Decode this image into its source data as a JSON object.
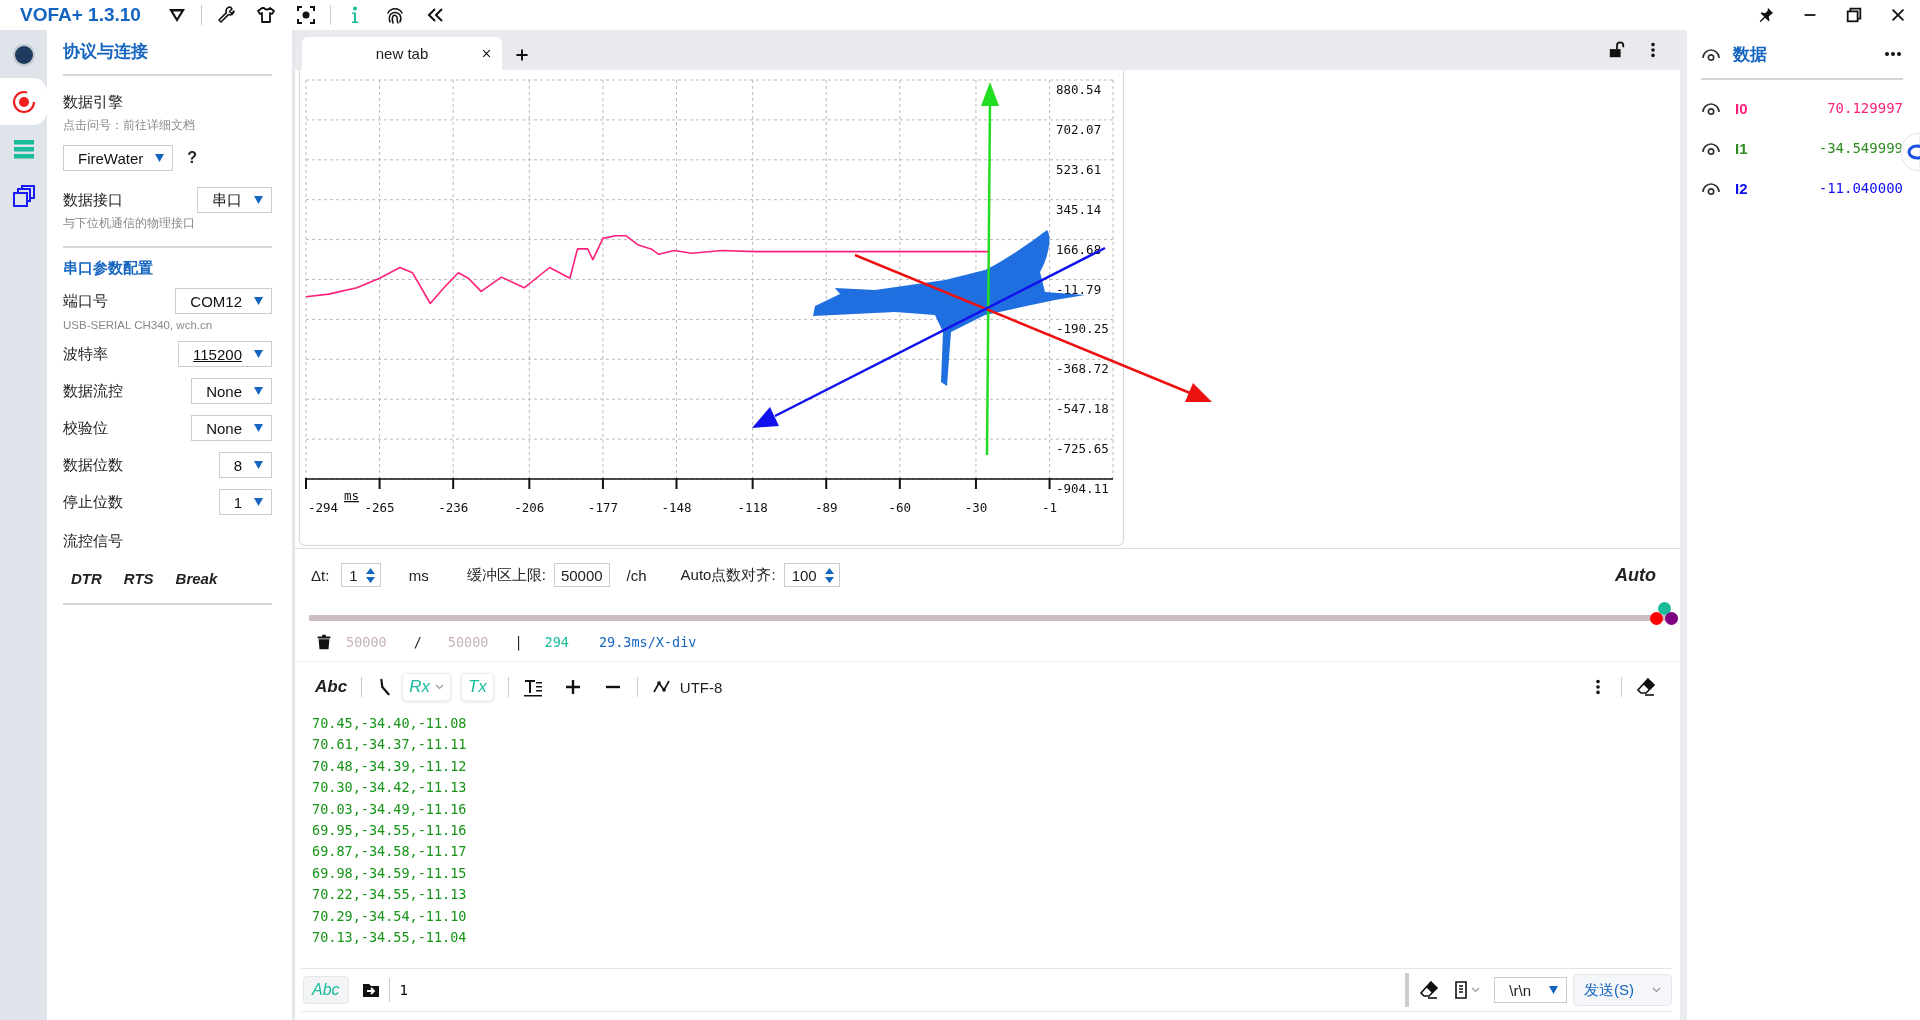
{
  "app": {
    "title": "VOFA+ 1.3.10"
  },
  "rail": [
    {
      "kind": "status",
      "selected": false
    },
    {
      "kind": "connection",
      "selected": true
    },
    {
      "kind": "commands",
      "selected": false
    },
    {
      "kind": "widgets",
      "selected": false
    }
  ],
  "connection_panel": {
    "title": "协议与连接",
    "engine": {
      "label": "数据引擎",
      "hint": "点击问号：前往详细文档",
      "value": "FireWater",
      "help": "?"
    },
    "interface": {
      "label": "数据接口",
      "value": "串口",
      "hint": "与下位机通信的物理接口"
    },
    "serial_title": "串口参数配置",
    "params": [
      {
        "label": "端口号",
        "value": "COM12",
        "note": "USB-SERIAL CH340, wch.cn",
        "editable": false
      },
      {
        "label": "波特率",
        "value": "115200",
        "editable": true
      },
      {
        "label": "数据流控",
        "value": "None",
        "editable": false
      },
      {
        "label": "校验位",
        "value": "None",
        "editable": false
      },
      {
        "label": "数据位数",
        "value": "8",
        "editable": false
      },
      {
        "label": "停止位数",
        "value": "1",
        "editable": false
      }
    ],
    "flow_signals": {
      "label": "流控信号",
      "buttons": [
        "DTR",
        "RTS",
        "Break"
      ]
    }
  },
  "tabs": [
    {
      "label": "new tab",
      "selected": true
    }
  ],
  "scope": {
    "chart_data": {
      "type": "line",
      "xlabel": "ms",
      "x": [
        -294,
        -285,
        -274,
        -265,
        -257,
        -252,
        -245,
        -240,
        -234,
        -230,
        -225,
        -217,
        -208,
        -198,
        -190,
        -187,
        -183,
        -181,
        -177,
        -172,
        -168,
        -163,
        -158,
        -155,
        -149,
        -142,
        -130,
        -117,
        -25
      ],
      "series": [
        {
          "color": "#ff1f7a",
          "values": [
            -89,
            -77,
            -49,
            -6,
            42,
            18,
            -119,
            -53,
            18,
            -6,
            -65,
            -1,
            -49,
            42,
            -6,
            125,
            125,
            77,
            172,
            184,
            184,
            142,
            125,
            101,
            118,
            106,
            118,
            113,
            113
          ]
        }
      ],
      "xlim": [
        -294,
        24
      ],
      "ylim": [
        -904.11,
        880.54
      ],
      "grid": true,
      "xticks": [
        -294,
        -265,
        -236,
        -206,
        -177,
        -148,
        -118,
        -89,
        -60,
        -30,
        -1
      ],
      "yticks": [
        880.54,
        702.07,
        523.61,
        345.14,
        166.68,
        -11.79,
        -190.25,
        -368.72,
        -547.18,
        -725.65,
        -904.11
      ]
    }
  },
  "settings": {
    "dt": {
      "label": "Δt:",
      "value": "1",
      "unit": "ms"
    },
    "buffer": {
      "label": "缓冲区上限:",
      "value": "50000",
      "unit": "/ch"
    },
    "align": {
      "label": "Auto点数对齐:",
      "value": "100"
    },
    "mode": "Auto"
  },
  "timeline": {
    "level": 1,
    "handles": [
      {
        "color": "#1abc9c"
      },
      {
        "color": "#ff0000"
      },
      {
        "color": "#800080"
      }
    ]
  },
  "stats": {
    "received": "50000",
    "slash": "/",
    "buffer": "50000",
    "bar": "|",
    "points": "294",
    "scale": "29.3ms/X-div"
  },
  "log_toolbar": {
    "format": "Abc",
    "rx": "Rx",
    "tx": "Tx",
    "encoding": "UTF-8"
  },
  "log_lines": [
    "70.45,-34.40,-11.08",
    "70.61,-34.37,-11.11",
    "70.48,-34.39,-11.12",
    "70.30,-34.42,-11.13",
    "70.03,-34.49,-11.16",
    "69.95,-34.55,-11.16",
    "69.87,-34.58,-11.17",
    "69.98,-34.59,-11.15",
    "70.22,-34.55,-11.13",
    "70.29,-34.54,-11.10",
    "70.13,-34.55,-11.04"
  ],
  "send_bar": {
    "mode": "Abc",
    "value": "1",
    "line_ending": "\\r\\n",
    "send": "发送(S)"
  },
  "data_panel": {
    "title": "数据",
    "channels": [
      {
        "name": "I0",
        "value": "70.129997",
        "color": "#ff1f7a"
      },
      {
        "name": "I1",
        "value": "-34.549999",
        "color": "#2e8b22"
      },
      {
        "name": "I2",
        "value": "-11.040000",
        "color": "#1010f0"
      }
    ]
  }
}
